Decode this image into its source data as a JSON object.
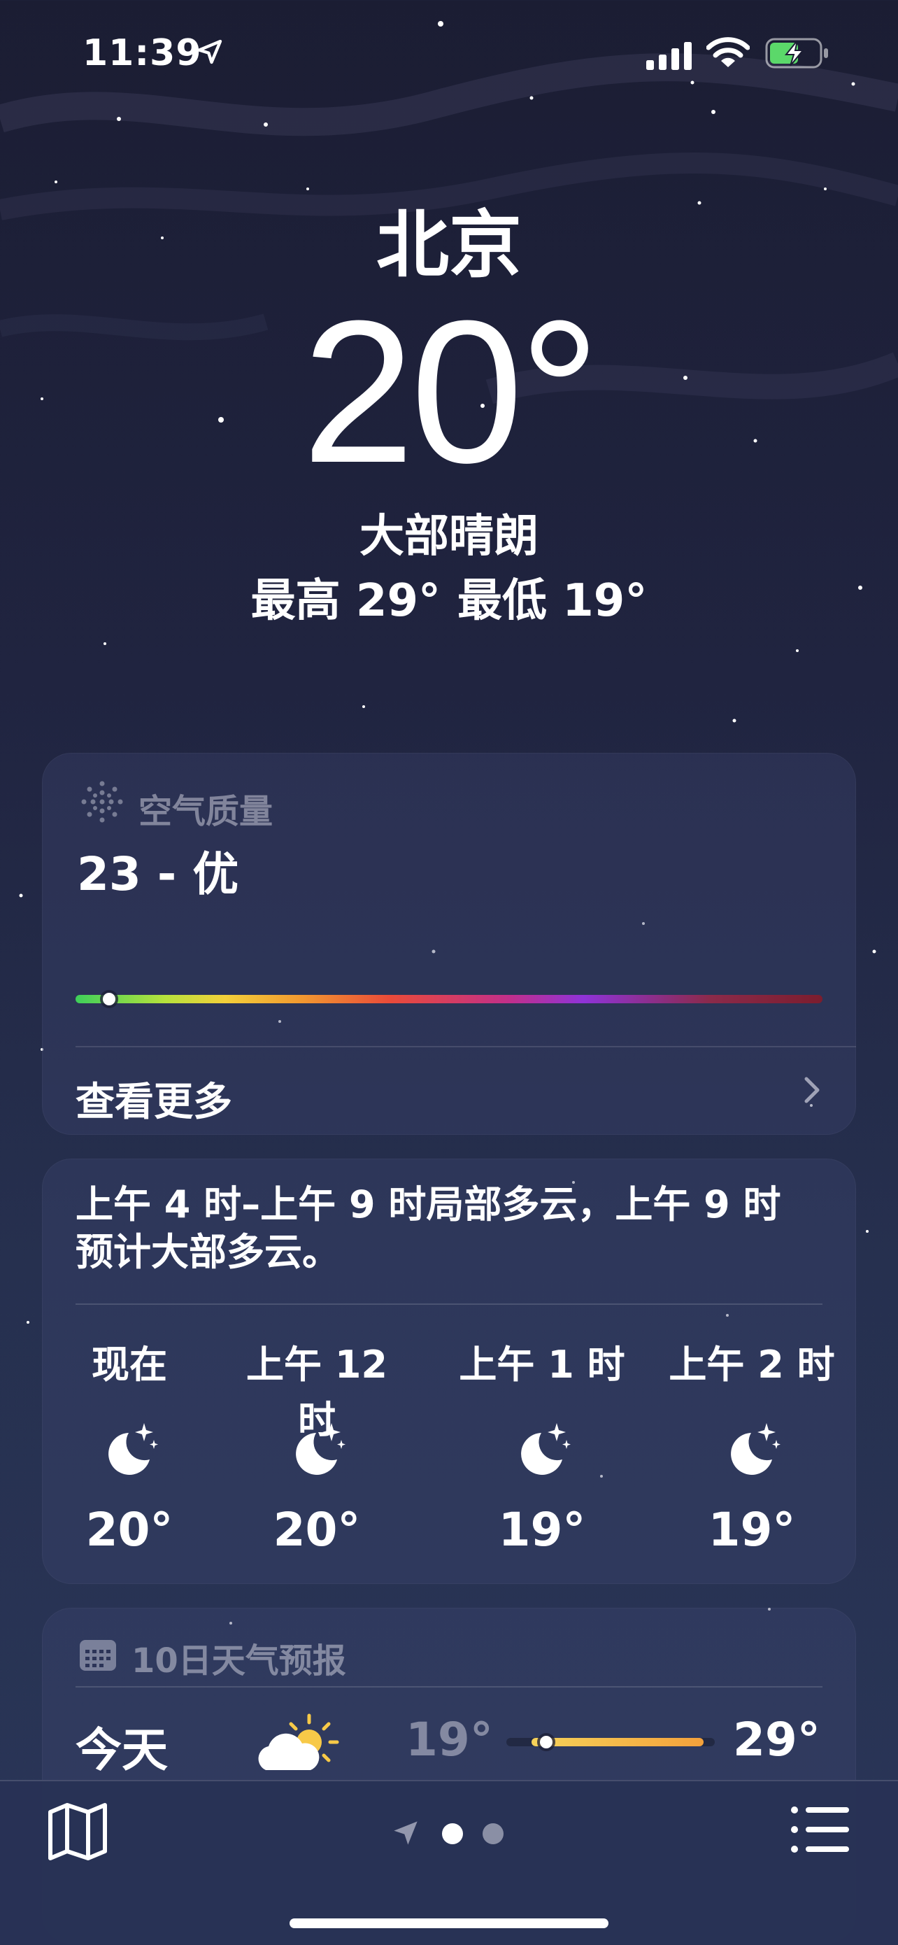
{
  "status_bar": {
    "time": "11:39"
  },
  "header": {
    "city": "北京",
    "temperature": "20°",
    "condition": "大部晴朗",
    "high": "最高 29°",
    "low": "最低 19°"
  },
  "air_quality": {
    "title": "空气质量",
    "value": "23 - 优",
    "level_fraction": 0.045,
    "see_more": "查看更多"
  },
  "hourly": {
    "summary": "上午 4 时–上午 9 时局部多云，上午 9 时预计大部多云。",
    "hours": [
      {
        "label": "现在",
        "icon": "moon-stars-icon",
        "temp": "20°"
      },
      {
        "label": "上午 12 时",
        "icon": "moon-stars-icon",
        "temp": "20°"
      },
      {
        "label": "上午 1 时",
        "icon": "moon-stars-icon",
        "temp": "19°"
      },
      {
        "label": "上午 2 时",
        "icon": "moon-stars-icon",
        "temp": "19°"
      }
    ]
  },
  "ten_day": {
    "title": "10日天气预报",
    "days": [
      {
        "label": "今天",
        "icon": "partly-cloudy-sun-icon",
        "low": "19°",
        "high": "29°"
      }
    ]
  },
  "colors": {
    "sky_top": "#1b1d33",
    "sky_bottom": "#2a3658",
    "range_bar": "#f4a13b"
  }
}
